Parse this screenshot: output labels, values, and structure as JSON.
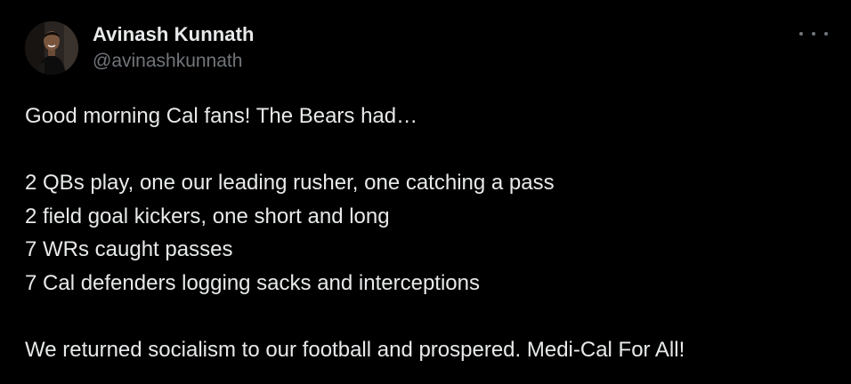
{
  "tweet": {
    "author": {
      "display_name": "Avinash Kunnath",
      "handle": "@avinashkunnath"
    },
    "more_icon": "more-horizontal-icon",
    "text_lines": [
      "Good morning Cal fans! The Bears had…",
      "",
      "2 QBs play, one our leading rusher, one catching a pass",
      "2 field goal kickers, one short and long",
      "7 WRs caught passes",
      "7 Cal defenders logging sacks and interceptions",
      "",
      "We returned socialism to our football and prospered. Medi-Cal For All!"
    ]
  },
  "colors": {
    "background": "#000000",
    "text_primary": "#e7e9ea",
    "text_secondary": "#71767b"
  }
}
